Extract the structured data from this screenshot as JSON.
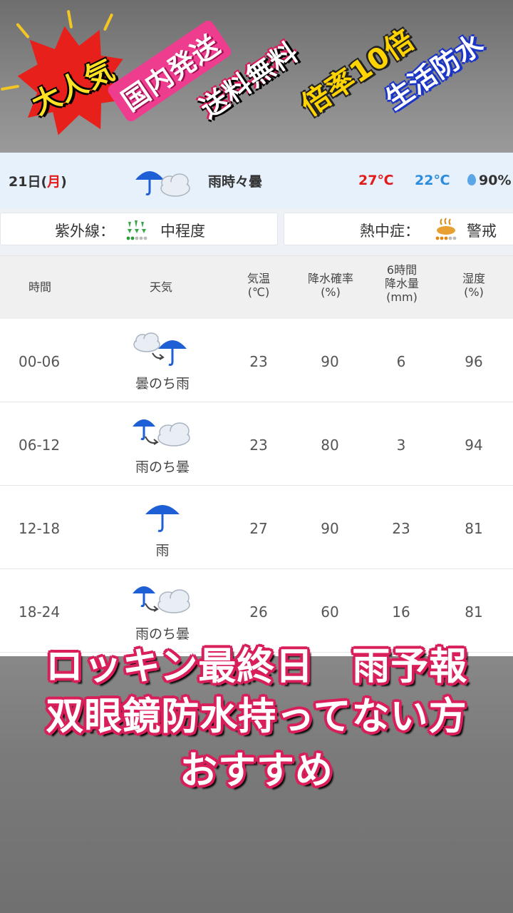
{
  "promo": {
    "badge1": "大人気",
    "badge2": "国内発送",
    "badge3": "送料無料",
    "badge4": "倍率10倍",
    "badge5": "生活防水"
  },
  "day": {
    "date_prefix": "21日(",
    "weekday": "月",
    "date_suffix": ")",
    "icon": "rain-then-cloud-icon",
    "condition": "雨時々曇",
    "high": "27℃",
    "low": "22℃",
    "humidity": "90%"
  },
  "info": {
    "uv_label": "紫外線：",
    "uv_value": "中程度",
    "heat_label": "熱中症：",
    "heat_value": "警戒"
  },
  "table": {
    "headers": {
      "time": "時間",
      "weather": "天気",
      "temp_line1": "気温",
      "temp_line2": "(℃)",
      "pop_line1": "降水確率",
      "pop_line2": "(%)",
      "precip_line1": "6時間",
      "precip_line2": "降水量",
      "precip_line3": "(mm)",
      "hum_line1": "湿度",
      "hum_line2": "(%)"
    },
    "rows": [
      {
        "time": "00-06",
        "icon": "cloud-then-rain-icon",
        "condition": "曇のち雨",
        "temp": "23",
        "pop": "90",
        "precip": "6",
        "humidity": "96"
      },
      {
        "time": "06-12",
        "icon": "rain-then-cloud-icon",
        "condition": "雨のち曇",
        "temp": "23",
        "pop": "80",
        "precip": "3",
        "humidity": "94"
      },
      {
        "time": "12-18",
        "icon": "umbrella-icon",
        "condition": "雨",
        "temp": "27",
        "pop": "90",
        "precip": "23",
        "humidity": "81"
      },
      {
        "time": "18-24",
        "icon": "rain-then-cloud-icon",
        "condition": "雨のち曇",
        "temp": "26",
        "pop": "60",
        "precip": "16",
        "humidity": "81"
      }
    ]
  },
  "caption": {
    "line1": "ロッキン最終日　雨予報",
    "line2": "双眼鏡防水持ってない方",
    "line3": "おすすめ"
  },
  "colors": {
    "high_temp": "#e11a1a",
    "low_temp": "#2d8ddc",
    "caption_outline": "#d81f5a",
    "umbrella": "#1e5fd6"
  }
}
